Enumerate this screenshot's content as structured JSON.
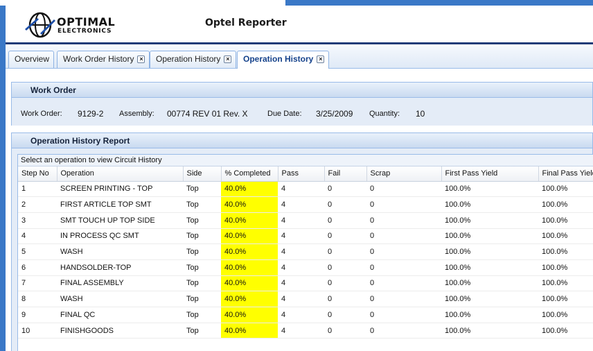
{
  "header": {
    "brand_name": "OPTIMAL",
    "brand_sub": "ELECTRONICS",
    "app_title": "Optel Reporter"
  },
  "tabs": [
    {
      "label": "Overview",
      "closable": false,
      "active": false
    },
    {
      "label": "Work Order History",
      "closable": true,
      "active": false
    },
    {
      "label": "Operation History",
      "closable": true,
      "active": false
    },
    {
      "label": "Operation History",
      "closable": true,
      "active": true
    }
  ],
  "close_glyph": "×",
  "work_order": {
    "title": "Work Order",
    "work_order_label": "Work Order:",
    "work_order_value": "9129-2",
    "assembly_label": "Assembly:",
    "assembly_value": "00774  REV 01 Rev. X",
    "due_date_label": "Due Date:",
    "due_date_value": "3/25/2009",
    "quantity_label": "Quantity:",
    "quantity_value": "10"
  },
  "report": {
    "title": "Operation History Report",
    "caption": "Select an operation to view Circuit History",
    "columns": [
      "Step No",
      "Operation",
      "Side",
      "% Completed",
      "Pass",
      "Fail",
      "Scrap",
      "First Pass Yield",
      "Final Pass Yield"
    ],
    "rows": [
      [
        "1",
        "SCREEN PRINTING - TOP",
        "Top",
        "40.0%",
        "4",
        "0",
        "0",
        "100.0%",
        "100.0%"
      ],
      [
        "2",
        "FIRST ARTICLE TOP SMT",
        "Top",
        "40.0%",
        "4",
        "0",
        "0",
        "100.0%",
        "100.0%"
      ],
      [
        "3",
        "SMT TOUCH UP TOP SIDE",
        "Top",
        "40.0%",
        "4",
        "0",
        "0",
        "100.0%",
        "100.0%"
      ],
      [
        "4",
        "IN PROCESS QC SMT",
        "Top",
        "40.0%",
        "4",
        "0",
        "0",
        "100.0%",
        "100.0%"
      ],
      [
        "5",
        "WASH",
        "Top",
        "40.0%",
        "4",
        "0",
        "0",
        "100.0%",
        "100.0%"
      ],
      [
        "6",
        "HANDSOLDER-TOP",
        "Top",
        "40.0%",
        "4",
        "0",
        "0",
        "100.0%",
        "100.0%"
      ],
      [
        "7",
        "FINAL ASSEMBLY",
        "Top",
        "40.0%",
        "4",
        "0",
        "0",
        "100.0%",
        "100.0%"
      ],
      [
        "8",
        "WASH",
        "Top",
        "40.0%",
        "4",
        "0",
        "0",
        "100.0%",
        "100.0%"
      ],
      [
        "9",
        "FINAL QC",
        "Top",
        "40.0%",
        "4",
        "0",
        "0",
        "100.0%",
        "100.0%"
      ],
      [
        "10",
        "FINISHGOODS",
        "Top",
        "40.0%",
        "4",
        "0",
        "0",
        "100.0%",
        "100.0%"
      ]
    ]
  },
  "colors": {
    "completed_highlight": "#ffff00",
    "accent": "#15428b",
    "frame": "#3a78c7"
  }
}
